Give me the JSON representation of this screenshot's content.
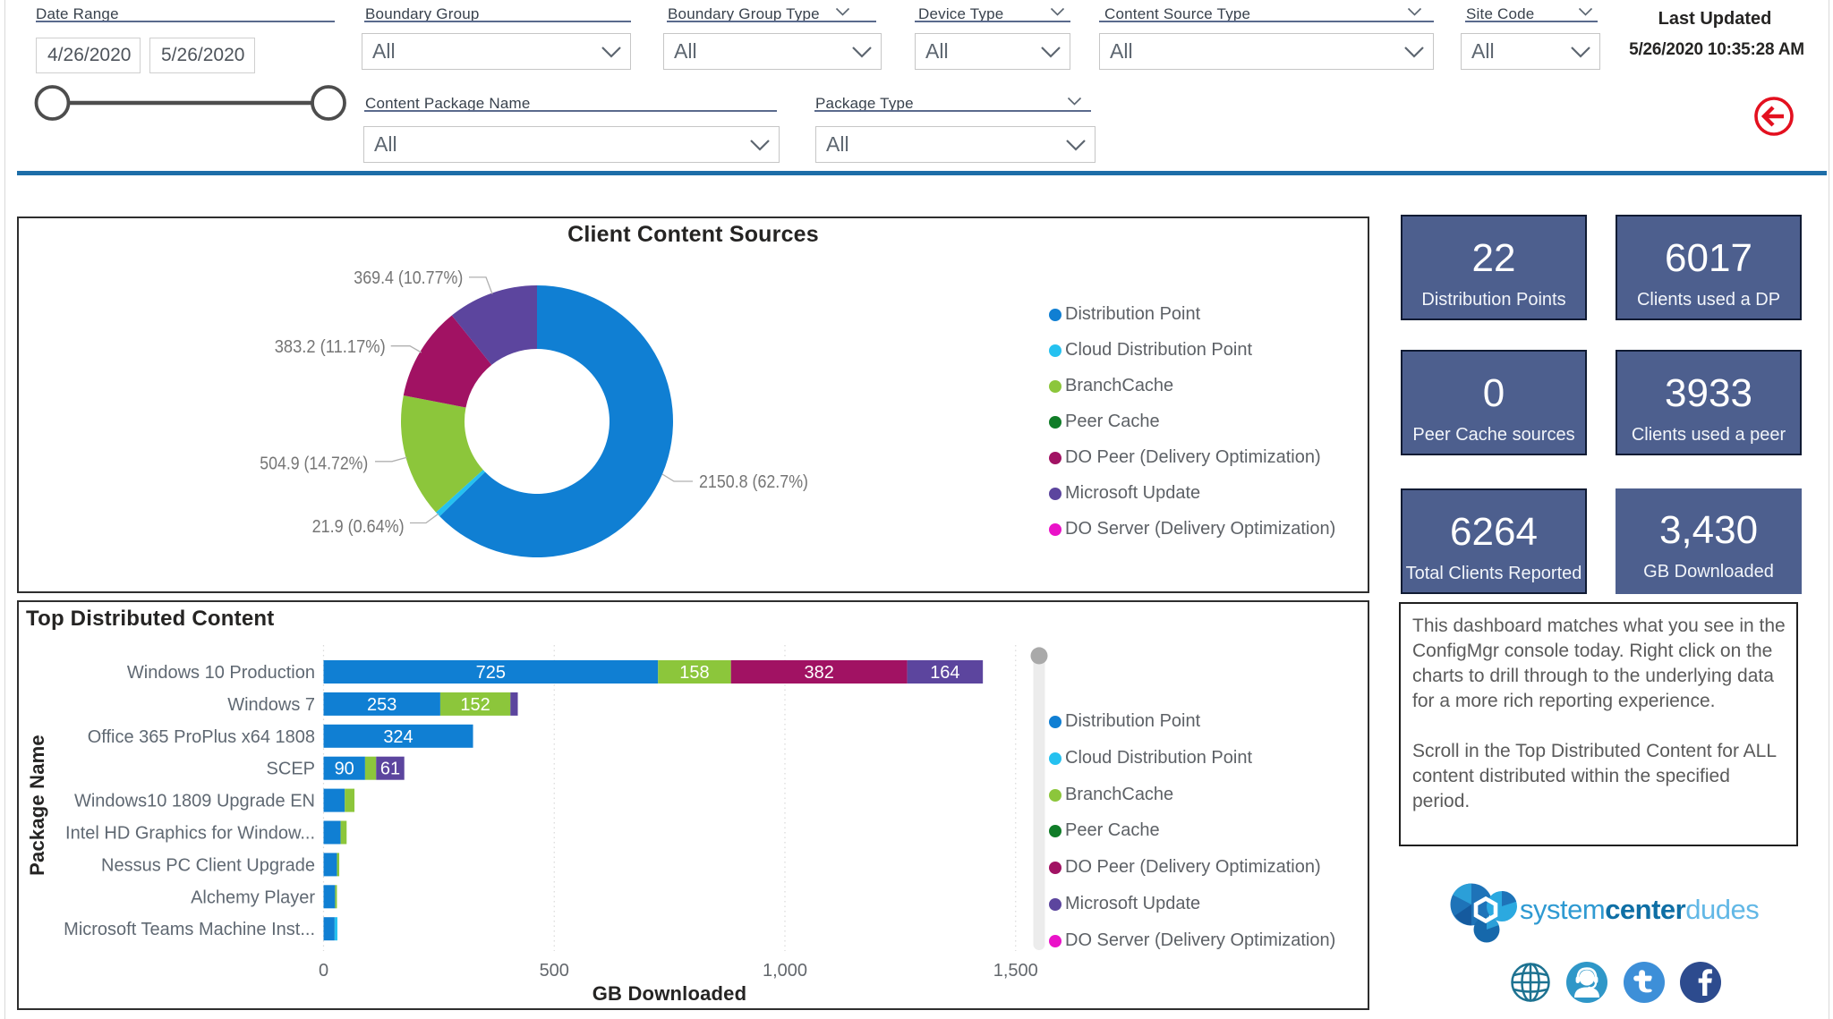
{
  "filters": {
    "date_range": {
      "label": "Date Range",
      "start": "4/26/2020",
      "end": "5/26/2020"
    },
    "boundary_group": {
      "label": "Boundary Group",
      "value": "All"
    },
    "boundary_group_type": {
      "label": "Boundary Group Type",
      "value": "All"
    },
    "device_type": {
      "label": "Device Type",
      "value": "All"
    },
    "content_source_type": {
      "label": "Content Source Type",
      "value": "All"
    },
    "site_code": {
      "label": "Site Code",
      "value": "All"
    },
    "content_package_name": {
      "label": "Content Package Name",
      "value": "All"
    },
    "package_type": {
      "label": "Package Type",
      "value": "All"
    }
  },
  "last_updated": {
    "label": "Last Updated",
    "value": "5/26/2020 10:35:28 AM"
  },
  "kpis": [
    {
      "value": "22",
      "label": "Distribution Points"
    },
    {
      "value": "6017",
      "label": "Clients used a DP"
    },
    {
      "value": "0",
      "label": "Peer Cache sources"
    },
    {
      "value": "3933",
      "label": "Clients used a peer"
    },
    {
      "value": "6264",
      "label": "Total Clients Reported"
    },
    {
      "value": "3,430",
      "label": "GB Downloaded"
    }
  ],
  "chart_data": [
    {
      "type": "donut",
      "title": "Client Content Sources",
      "legend_position": "right",
      "slices": [
        {
          "name": "Distribution Point",
          "color": "#107fd3",
          "value": 2150.8,
          "callout": "2150.8 (62.7%)"
        },
        {
          "name": "Cloud Distribution Point",
          "color": "#25c1f0",
          "value": 21.9,
          "callout": "21.9 (0.64%)"
        },
        {
          "name": "BranchCache",
          "color": "#8cc63b",
          "value": 504.9,
          "callout": "504.9 (14.72%)"
        },
        {
          "name": "Peer Cache",
          "color": "#107c28",
          "value": 0,
          "callout": ""
        },
        {
          "name": "DO Peer (Delivery Optimization)",
          "color": "#a11263",
          "value": 383.2,
          "callout": "383.2 (11.17%)"
        },
        {
          "name": "Microsoft Update",
          "color": "#5c459e",
          "value": 369.4,
          "callout": "369.4 (10.77%)"
        },
        {
          "name": "DO Server (Delivery Optimization)",
          "color": "#ea12c8",
          "value": 0,
          "callout": ""
        }
      ]
    },
    {
      "type": "bar",
      "title": "Top Distributed Content",
      "xlabel": "GB Downloaded",
      "ylabel": "Package Name",
      "xlim": [
        0,
        1550
      ],
      "x_ticks": [
        {
          "value": 0,
          "label": "0"
        },
        {
          "value": 500,
          "label": "500"
        },
        {
          "value": 1000,
          "label": "1,000"
        },
        {
          "value": 1500,
          "label": "1,500"
        }
      ],
      "categories": [
        "Windows 10 Production",
        "Windows 7",
        "Office 365 ProPlus x64 1808",
        "SCEP",
        "Windows10 1809 Upgrade EN",
        "Intel HD Graphics for Window...",
        "Nessus PC Client Upgrade",
        "Alchemy Player",
        "Microsoft Teams Machine Inst..."
      ],
      "series": [
        {
          "name": "Distribution Point",
          "color": "#107fd3",
          "values": [
            725,
            253,
            324,
            90,
            46,
            37,
            29,
            25,
            24
          ]
        },
        {
          "name": "Cloud Distribution Point",
          "color": "#25c1f0",
          "values": [
            0,
            0,
            0,
            0,
            0,
            0,
            0,
            0,
            6
          ]
        },
        {
          "name": "BranchCache",
          "color": "#8cc63b",
          "values": [
            158,
            152,
            0,
            24,
            21,
            13,
            5,
            4,
            0
          ]
        },
        {
          "name": "Peer Cache",
          "color": "#107c28",
          "values": [
            0,
            0,
            0,
            0,
            0,
            0,
            0,
            0,
            0
          ]
        },
        {
          "name": "DO Peer (Delivery Optimization)",
          "color": "#a11263",
          "values": [
            382,
            0,
            0,
            0,
            0,
            0,
            0,
            0,
            0
          ]
        },
        {
          "name": "Microsoft Update",
          "color": "#5c459e",
          "values": [
            164,
            16,
            0,
            61,
            0,
            0,
            0,
            0,
            0
          ]
        },
        {
          "name": "DO Server (Delivery Optimization)",
          "color": "#ea12c8",
          "values": [
            0,
            0,
            0,
            0,
            0,
            0,
            0,
            0,
            0
          ]
        }
      ]
    }
  ],
  "note": {
    "text": "This dashboard matches what you see in the\nConfigMgr console today. Right click on the\ncharts to drill through to the underlying data\nfor a more rich reporting experience.\n\nScroll in the Top Distributed Content for ALL\ncontent distributed within the specified\nperiod."
  },
  "logo": {
    "part1": "system",
    "part2": "center",
    "part3": "dudes"
  }
}
